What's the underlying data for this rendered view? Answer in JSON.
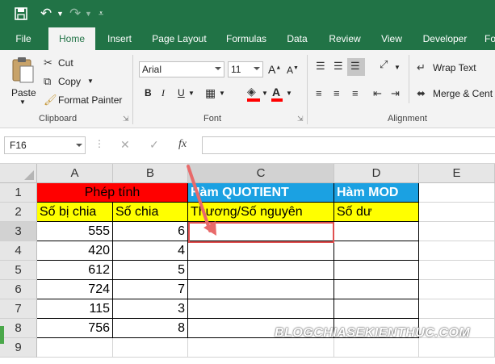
{
  "qat": {
    "save_icon": "save-icon",
    "undo_icon": "undo-icon",
    "redo_icon": "redo-icon",
    "customize_icon": "qat-customize-icon"
  },
  "tabs": [
    {
      "label": "File"
    },
    {
      "label": "Home"
    },
    {
      "label": "Insert"
    },
    {
      "label": "Page Layout"
    },
    {
      "label": "Formulas"
    },
    {
      "label": "Data"
    },
    {
      "label": "Review"
    },
    {
      "label": "View"
    },
    {
      "label": "Developer"
    },
    {
      "label": "Fo"
    }
  ],
  "active_tab": "Home",
  "clipboard": {
    "paste_label": "Paste",
    "cut_label": "Cut",
    "copy_label": "Copy",
    "format_painter_label": "Format Painter",
    "group_label": "Clipboard"
  },
  "font": {
    "font_name": "Arial",
    "font_size": "11",
    "group_label": "Font",
    "bold": "B",
    "italic": "I",
    "underline": "U"
  },
  "alignment": {
    "wrap_text_label": "Wrap Text",
    "merge_label": "Merge & Cent",
    "group_label": "Alignment"
  },
  "formula_bar": {
    "name_box": "F16",
    "fx_label": "fx",
    "formula": ""
  },
  "columns": [
    "A",
    "B",
    "C",
    "D",
    "E"
  ],
  "rows": [
    "1",
    "2",
    "3",
    "4",
    "5",
    "6",
    "7",
    "8",
    "9"
  ],
  "cells": {
    "r1": {
      "ab": "Phép tính",
      "c": "Hàm QUOTIENT",
      "d": "Hàm MOD"
    },
    "r2": {
      "a": "Số bị chia",
      "b": "Số chia",
      "c": "Thương/Số nguyên",
      "d": "Số dư"
    },
    "data": [
      {
        "a": "555",
        "b": "6"
      },
      {
        "a": "420",
        "b": "4"
      },
      {
        "a": "612",
        "b": "5"
      },
      {
        "a": "724",
        "b": "7"
      },
      {
        "a": "115",
        "b": "3"
      },
      {
        "a": "756",
        "b": "8"
      }
    ]
  },
  "watermark": "BLOGCHIASEKIENTHUC.COM",
  "colors": {
    "excel_green": "#217346",
    "header_red": "#ff0000",
    "header_blue": "#1ba1e2",
    "header_yellow": "#ffff00",
    "selection_border": "#e05050"
  }
}
